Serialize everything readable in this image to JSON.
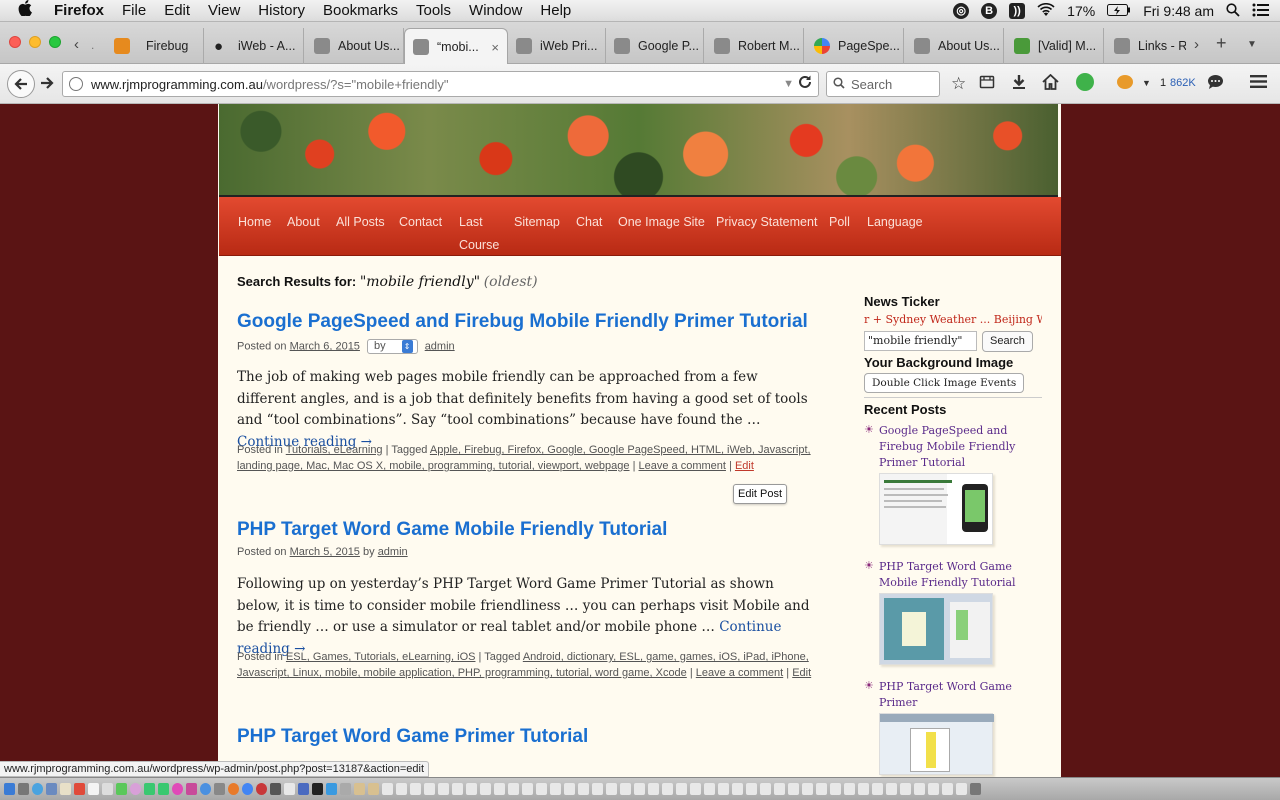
{
  "menubar": {
    "apple": "",
    "items": [
      "Firefox",
      "File",
      "Edit",
      "View",
      "History",
      "Bookmarks",
      "Tools",
      "Window",
      "Help"
    ],
    "battery": "17%",
    "clock": "Fri 9:48 am"
  },
  "tabs": [
    {
      "label": "Firebug",
      "icon": "firebug-icon"
    },
    {
      "label": "iWeb - A...",
      "icon": "apple-icon"
    },
    {
      "label": "About Us...",
      "icon": "page-icon"
    },
    {
      "label": "“mobi...",
      "icon": "page-icon",
      "active": true,
      "close": "×"
    },
    {
      "label": "iWeb Pri...",
      "icon": "page-icon"
    },
    {
      "label": "Google P...",
      "icon": "page-icon"
    },
    {
      "label": "Robert M...",
      "icon": "page-icon"
    },
    {
      "label": "PageSpe...",
      "icon": "google-icon"
    },
    {
      "label": "About Us...",
      "icon": "page-icon"
    },
    {
      "label": "[Valid] M...",
      "icon": "green-square-icon"
    },
    {
      "label": "Links - R...",
      "icon": "page-icon"
    }
  ],
  "navbar": {
    "url_host": "www.rjmprogramming.com.au",
    "url_path": "/wordpress/?s=\"mobile+friendly\"",
    "search_placeholder": "Search",
    "firebug_count": "1",
    "download_size": "862K"
  },
  "site_nav": {
    "items": [
      "Home",
      "About",
      "All Posts",
      "Contact",
      "Last",
      "Course",
      "Sitemap",
      "Chat",
      "One Image Site",
      "Privacy Statement",
      "Poll",
      "Language"
    ]
  },
  "results": {
    "label": "Search Results for:",
    "query": "\"mobile friendly\"",
    "order": "(oldest)"
  },
  "posts": [
    {
      "title": "Google PageSpeed and Firebug Mobile Friendly Primer Tutorial",
      "posted_on": "Posted on",
      "date": "March 6, 2015",
      "by": "by",
      "author": "admin",
      "excerpt": "The job of making web pages mobile friendly can be approached from a few different angles, and is a job that definitely benefits from having a good set of tools and “tool combinations”. Say “tool combinations” because have found the …",
      "continue": "Continue reading →",
      "posted_in": "Posted in",
      "categories": "Tutorials, eLearning",
      "tagged": "| Tagged",
      "tags": "Apple, Firebug, Firefox, Google, Google PageSpeed, HTML, iWeb, Javascript, landing page, Mac, Mac OS X, mobile, programming, tutorial, viewport, webpage",
      "comment": "Leave a comment",
      "edit": "Edit",
      "edit_button": "Edit Post"
    },
    {
      "title": "PHP Target Word Game Mobile Friendly Tutorial",
      "posted_on": "Posted on",
      "date": "March 5, 2015",
      "by": "by",
      "author": "admin",
      "excerpt": "Following up on yesterday’s PHP Target Word Game Primer Tutorial as shown below, it is time to consider mobile friendliness … you can perhaps visit Mobile and be friendly … or use a simulator or real tablet and/or mobile phone …",
      "continue": "Continue reading →",
      "posted_in": "Posted in",
      "categories": "ESL, Games, Tutorials, eLearning, iOS",
      "tagged": "| Tagged",
      "tags": "Android, dictionary, ESL, game, games, iOS, iPad, iPhone, Javascript, Linux, mobile, mobile application, PHP, programming, tutorial, word game, Xcode",
      "comment": "Leave a comment",
      "edit": "Edit"
    },
    {
      "title": "PHP Target Word Game Primer Tutorial"
    }
  ],
  "sidebar": {
    "news_ticker_title": "News Ticker",
    "ticker_text": "r + Sydney Weather ... Beijing Weath",
    "search_value": "\"mobile friendly\"",
    "search_button": "Search",
    "bg_title": "Your Background Image",
    "bg_button": "Double Click Image Events",
    "recent_title": "Recent Posts",
    "recent": [
      "Google PageSpeed and Firebug Mobile Friendly Primer Tutorial",
      "PHP Target Word Game Mobile Friendly Tutorial",
      "PHP Target Word Game Primer"
    ]
  },
  "statusbar": {
    "text": "www.rjmprogramming.com.au/wordpress/wp-admin/post.php?post=13187&action=edit"
  },
  "colors": {
    "page_bg": "#fffbf0",
    "outer_bg": "#5a1414",
    "nav_red": "#d23a22",
    "title_blue": "#1a6fd0"
  }
}
